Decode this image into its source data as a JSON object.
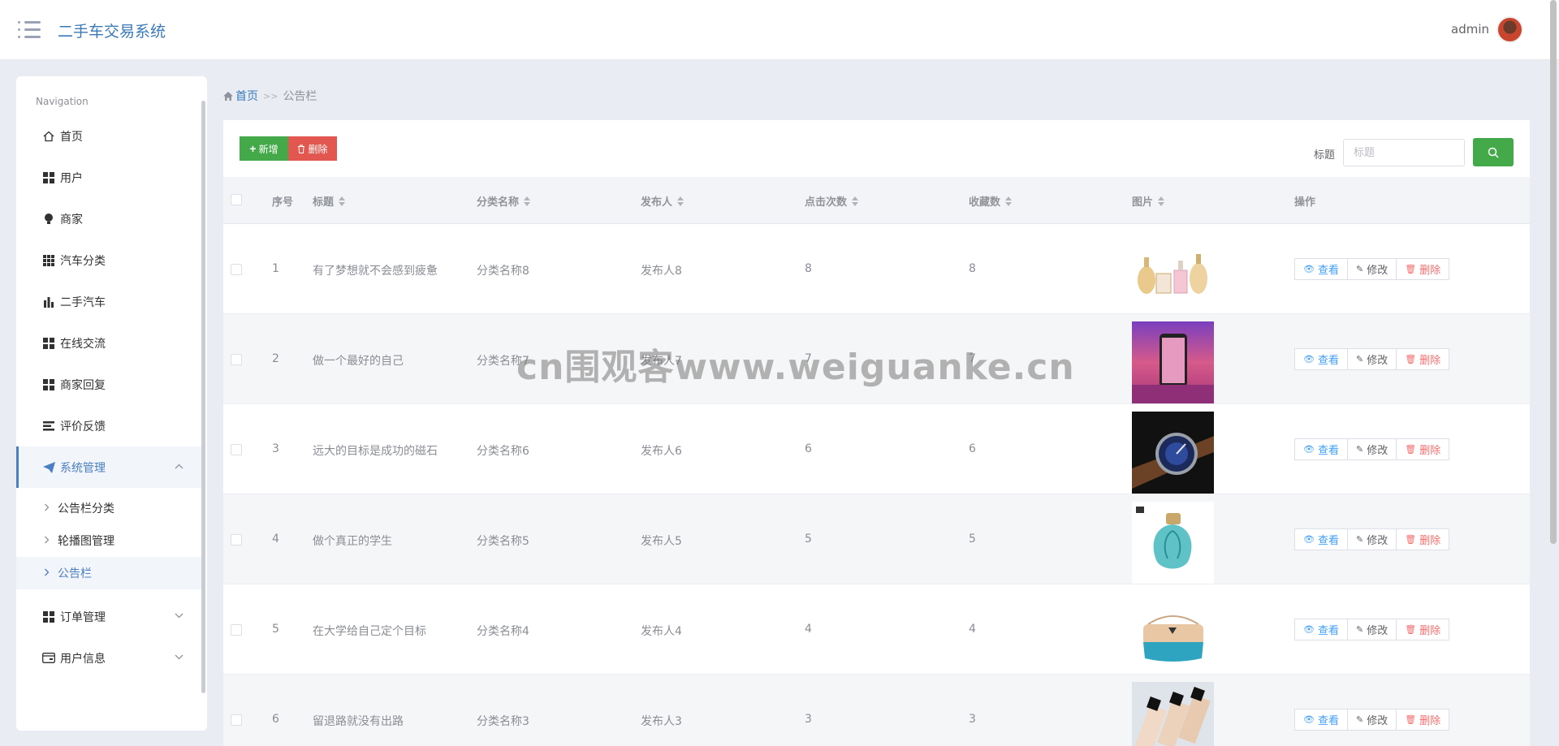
{
  "header": {
    "title": "二手车交易系统",
    "user": "admin"
  },
  "sidebar": {
    "nav_title": "Navigation",
    "items": [
      {
        "label": "首页",
        "icon": "home-icon"
      },
      {
        "label": "用户",
        "icon": "grid-icon"
      },
      {
        "label": "商家",
        "icon": "bulb-icon"
      },
      {
        "label": "汽车分类",
        "icon": "grid-nine-icon"
      },
      {
        "label": "二手汽车",
        "icon": "bar-chart-icon"
      },
      {
        "label": "在线交流",
        "icon": "grid-icon"
      },
      {
        "label": "商家回复",
        "icon": "grid-icon"
      },
      {
        "label": "评价反馈",
        "icon": "list-icon"
      },
      {
        "label": "系统管理",
        "icon": "paper-plane-icon"
      },
      {
        "label": "订单管理",
        "icon": "grid-icon"
      },
      {
        "label": "用户信息",
        "icon": "card-icon"
      }
    ],
    "sub_items": [
      {
        "label": "公告栏分类"
      },
      {
        "label": "轮播图管理"
      },
      {
        "label": "公告栏"
      }
    ]
  },
  "breadcrumb": {
    "home": "首页",
    "sep": ">>",
    "current": "公告栏"
  },
  "toolbar": {
    "add_label": "新增",
    "delete_label": "删除",
    "search_label": "标题",
    "search_placeholder": "标题"
  },
  "table": {
    "columns": [
      "序号",
      "标题",
      "分类名称",
      "发布人",
      "点击次数",
      "收藏数",
      "图片",
      "操作"
    ],
    "rows": [
      {
        "no": "1",
        "title": "有了梦想就不会感到疲惫",
        "category": "分类名称8",
        "publisher": "发布人8",
        "clicks": "8",
        "favorites": "8"
      },
      {
        "no": "2",
        "title": "做一个最好的自己",
        "category": "分类名称7",
        "publisher": "发布人7",
        "clicks": "7",
        "favorites": "7"
      },
      {
        "no": "3",
        "title": "远大的目标是成功的磁石",
        "category": "分类名称6",
        "publisher": "发布人6",
        "clicks": "6",
        "favorites": "6"
      },
      {
        "no": "4",
        "title": "做个真正的学生",
        "category": "分类名称5",
        "publisher": "发布人5",
        "clicks": "5",
        "favorites": "5"
      },
      {
        "no": "5",
        "title": "在大学给自己定个目标",
        "category": "分类名称4",
        "publisher": "发布人4",
        "clicks": "4",
        "favorites": "4"
      },
      {
        "no": "6",
        "title": "留退路就没有出路",
        "category": "分类名称3",
        "publisher": "发布人3",
        "clicks": "3",
        "favorites": "3"
      }
    ],
    "actions": {
      "view": "查看",
      "edit": "修改",
      "delete": "删除"
    }
  },
  "watermark": "cn围观客www.weiguanke.cn",
  "colors": {
    "accent": "#3a7ab8",
    "success": "#44a948",
    "danger": "#e25850"
  }
}
